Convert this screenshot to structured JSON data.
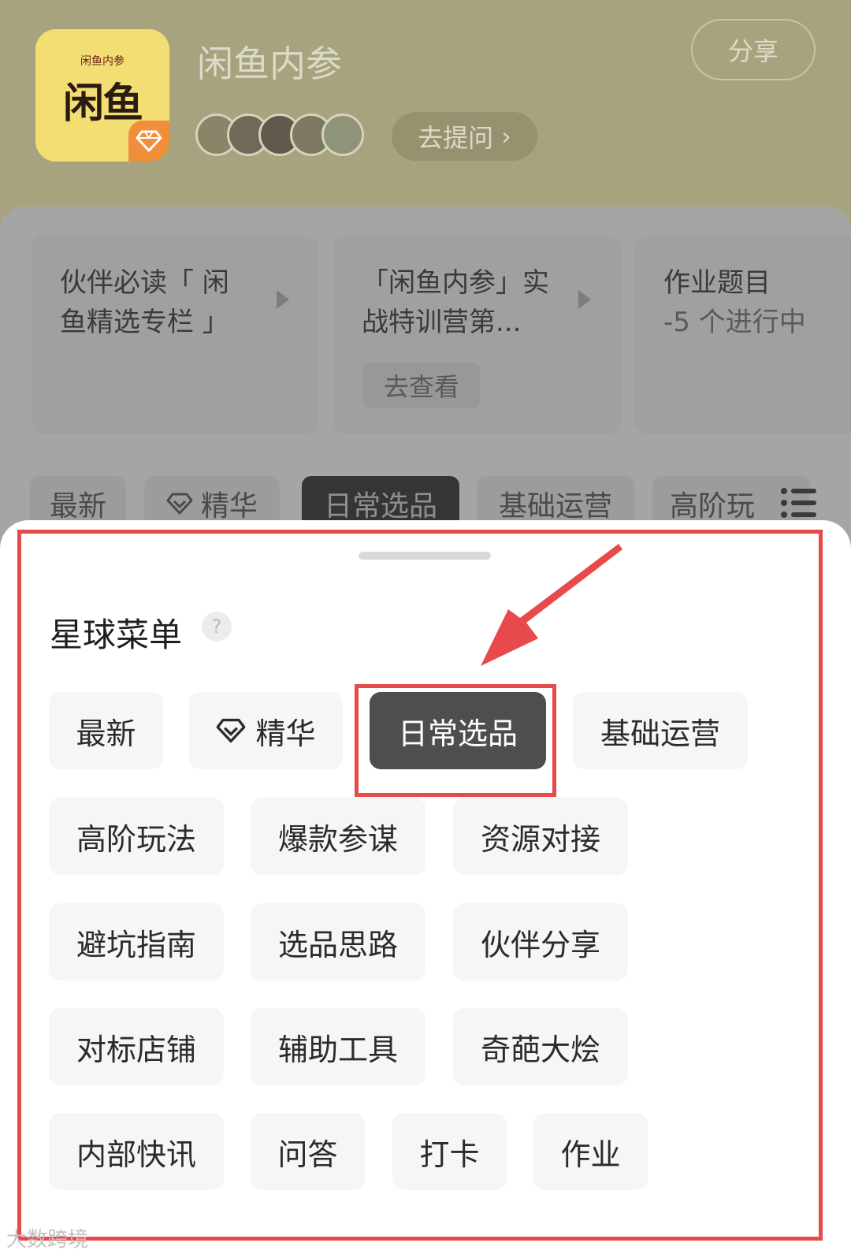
{
  "header": {
    "logo_sub": "闲鱼内参",
    "logo_big": "闲鱼",
    "logo_tag": "",
    "group_title": "闲鱼内参",
    "share_label": "分享",
    "ask_label": "去提问",
    "ask_chevron": "›"
  },
  "cards": [
    {
      "line1": "伙伴必读「 闲",
      "line2": "鱼精选专栏 」"
    },
    {
      "line1": "「闲鱼内参」实",
      "line2": "战特训营第...",
      "button": "去查看"
    },
    {
      "line1": "作业题目",
      "line2": "-5 个进行中"
    }
  ],
  "tabs": [
    "最新",
    "精华",
    "日常选品",
    "基础运营",
    "高阶玩"
  ],
  "menu": {
    "title": "星球菜单",
    "help": "?",
    "rows": [
      [
        "最新",
        "精华",
        "日常选品",
        "基础运营"
      ],
      [
        "高阶玩法",
        "爆款参谋",
        "资源对接"
      ],
      [
        "避坑指南",
        "选品思路",
        "伙伴分享"
      ],
      [
        "对标店铺",
        "辅助工具",
        "奇葩大烩"
      ],
      [
        "内部快讯",
        "问答",
        "打卡",
        "作业"
      ]
    ],
    "active": "日常选品"
  },
  "colors": {
    "annotation_red": "#e8494a",
    "active_chip": "#4e4e4e",
    "chip_bg": "#f5f6f7"
  },
  "watermark": "大数跨境"
}
